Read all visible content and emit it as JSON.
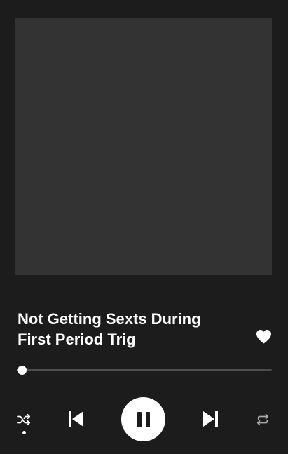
{
  "track": {
    "title": "Not Getting Sexts During First Period Trig",
    "liked": true
  },
  "progress": {
    "fraction": 0.02
  },
  "controls": {
    "shuffle_icon": "shuffle-icon",
    "shuffle_active": true,
    "previous_icon": "skip-previous-icon",
    "play_state_icon": "pause-icon",
    "next_icon": "skip-next-icon",
    "repeat_icon": "repeat-icon"
  },
  "colors": {
    "background": "#1c1c1c",
    "album_art_placeholder": "#333333",
    "progress_track": "#4d4d4d",
    "foreground": "#ffffff",
    "inactive_icon": "#a9a9a9"
  }
}
